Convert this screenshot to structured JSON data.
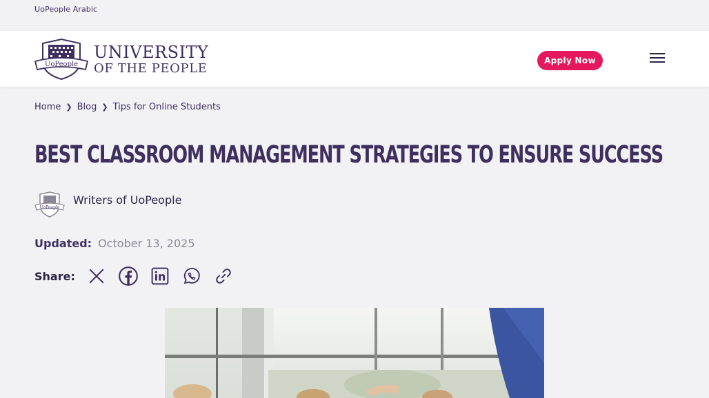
{
  "topbar": {
    "link": "UoPeople Arabic"
  },
  "header": {
    "logo_badge": "UoPeople",
    "logo_line1": "UNIVERSITY",
    "logo_line2": "OF THE PEOPLE",
    "apply_label": "Apply Now"
  },
  "breadcrumb": [
    {
      "label": "Home"
    },
    {
      "label": "Blog"
    },
    {
      "label": "Tips for Online Students"
    }
  ],
  "article": {
    "title": "Best Classroom Management Strategies To Ensure Success",
    "author": "Writers of UoPeople",
    "updated_label": "Updated:",
    "updated_date": "October 13, 2025",
    "share_label": "Share:",
    "share_icons": [
      "x-icon",
      "facebook-icon",
      "linkedin-icon",
      "whatsapp-icon",
      "link-icon"
    ]
  },
  "colors": {
    "brand_purple": "#3e2f5f",
    "accent_pink": "#e5175d",
    "background": "#f2f2f5"
  }
}
